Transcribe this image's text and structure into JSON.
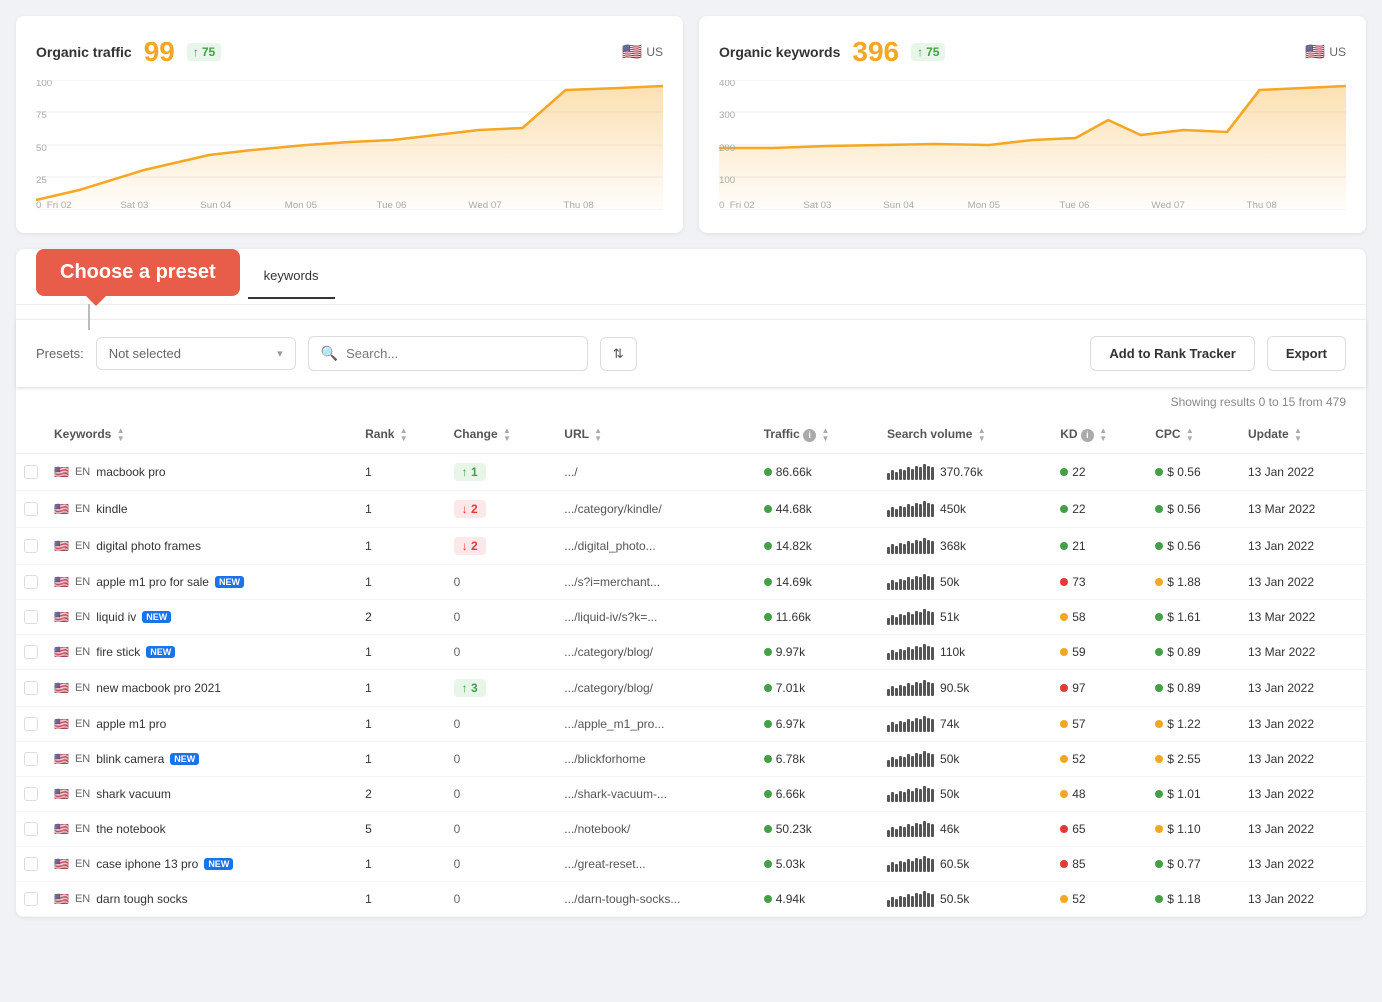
{
  "charts": {
    "organic_traffic": {
      "title": "Organic traffic",
      "value": "99",
      "badge": "75",
      "country": "US",
      "y_labels": [
        "100",
        "75",
        "50",
        "25",
        "0"
      ],
      "x_labels": [
        "Fri 02",
        "Sat 03",
        "Sun 04",
        "Mon 05",
        "Tue 06",
        "Wed 07",
        "Thu 08"
      ]
    },
    "organic_keywords": {
      "title": "Organic keywords",
      "value": "396",
      "badge": "75",
      "country": "US",
      "y_labels": [
        "400",
        "300",
        "200",
        "100",
        "0"
      ],
      "x_labels": [
        "Fri 02",
        "Sat 03",
        "Sun 04",
        "Mon 05",
        "Tue 06",
        "Wed 07",
        "Thu 08"
      ]
    }
  },
  "tabs": [
    {
      "label": "keywords",
      "active": true
    }
  ],
  "tooltip": {
    "text": "Choose a preset"
  },
  "filters": {
    "presets_label": "Presets:",
    "presets_value": "Not selected",
    "search_placeholder": "Search...",
    "add_rank_label": "Add to Rank Tracker",
    "export_label": "Export"
  },
  "table": {
    "results_text": "Showing results 0 to 15 from 479",
    "columns": [
      "Keywords",
      "Rank",
      "Change",
      "URL",
      "Traffic",
      "Search volume",
      "KD",
      "CPC",
      "Update"
    ],
    "rows": [
      {
        "flag": "🇺🇸",
        "lang": "EN",
        "keyword": "macbook pro",
        "new": false,
        "rank": 1,
        "change": "+1",
        "change_type": "up",
        "url": ".../",
        "traffic": "86.66k",
        "traffic_dot": "green",
        "sv": "370.76k",
        "kd": 22,
        "kd_dot": "green",
        "cpc": "$ 0.56",
        "cpc_dot": "green",
        "update": "13 Jan 2022"
      },
      {
        "flag": "🇺🇸",
        "lang": "EN",
        "keyword": "kindle",
        "new": false,
        "rank": 1,
        "change": "-2",
        "change_type": "down",
        "url": ".../category/kindle/",
        "traffic": "44.68k",
        "traffic_dot": "green",
        "sv": "450k",
        "kd": 22,
        "kd_dot": "green",
        "cpc": "$ 0.56",
        "cpc_dot": "green",
        "update": "13 Mar 2022"
      },
      {
        "flag": "🇺🇸",
        "lang": "EN",
        "keyword": "digital photo frames",
        "new": false,
        "rank": 1,
        "change": "-2",
        "change_type": "down",
        "url": ".../digital_photo...",
        "traffic": "14.82k",
        "traffic_dot": "green",
        "sv": "368k",
        "kd": 21,
        "kd_dot": "green",
        "cpc": "$ 0.56",
        "cpc_dot": "green",
        "update": "13 Jan 2022"
      },
      {
        "flag": "🇺🇸",
        "lang": "EN",
        "keyword": "apple m1 pro for sale",
        "new": true,
        "rank": 1,
        "change": "0",
        "change_type": "zero",
        "url": ".../s?i=merchant...",
        "traffic": "14.69k",
        "traffic_dot": "green",
        "sv": "50k",
        "kd": 73,
        "kd_dot": "red",
        "cpc": "$ 1.88",
        "cpc_dot": "yellow",
        "update": "13 Jan 2022"
      },
      {
        "flag": "🇺🇸",
        "lang": "EN",
        "keyword": "liquid iv",
        "new": true,
        "rank": 2,
        "change": "0",
        "change_type": "zero",
        "url": ".../liquid-iv/s?k=...",
        "traffic": "11.66k",
        "traffic_dot": "green",
        "sv": "51k",
        "kd": 58,
        "kd_dot": "yellow",
        "cpc": "$ 1.61",
        "cpc_dot": "green",
        "update": "13 Mar 2022"
      },
      {
        "flag": "🇺🇸",
        "lang": "EN",
        "keyword": "fire stick",
        "new": true,
        "rank": 1,
        "change": "0",
        "change_type": "zero",
        "url": ".../category/blog/",
        "traffic": "9.97k",
        "traffic_dot": "green",
        "sv": "110k",
        "kd": 59,
        "kd_dot": "yellow",
        "cpc": "$ 0.89",
        "cpc_dot": "green",
        "update": "13 Mar 2022"
      },
      {
        "flag": "🇺🇸",
        "lang": "EN",
        "keyword": "new macbook pro 2021",
        "new": false,
        "rank": 1,
        "change": "+3",
        "change_type": "up",
        "url": ".../category/blog/",
        "traffic": "7.01k",
        "traffic_dot": "green",
        "sv": "90.5k",
        "kd": 97,
        "kd_dot": "red",
        "cpc": "$ 0.89",
        "cpc_dot": "green",
        "update": "13 Jan 2022"
      },
      {
        "flag": "🇺🇸",
        "lang": "EN",
        "keyword": "apple m1 pro",
        "new": false,
        "rank": 1,
        "change": "0",
        "change_type": "zero",
        "url": ".../apple_m1_pro...",
        "traffic": "6.97k",
        "traffic_dot": "green",
        "sv": "74k",
        "kd": 57,
        "kd_dot": "yellow",
        "cpc": "$ 1.22",
        "cpc_dot": "yellow",
        "update": "13 Jan 2022"
      },
      {
        "flag": "🇺🇸",
        "lang": "EN",
        "keyword": "blink camera",
        "new": true,
        "rank": 1,
        "change": "0",
        "change_type": "zero",
        "url": ".../blickforhome",
        "traffic": "6.78k",
        "traffic_dot": "green",
        "sv": "50k",
        "kd": 52,
        "kd_dot": "yellow",
        "cpc": "$ 2.55",
        "cpc_dot": "yellow",
        "update": "13 Jan 2022"
      },
      {
        "flag": "🇺🇸",
        "lang": "EN",
        "keyword": "shark vacuum",
        "new": false,
        "rank": 2,
        "change": "0",
        "change_type": "zero",
        "url": ".../shark-vacuum-...",
        "traffic": "6.66k",
        "traffic_dot": "green",
        "sv": "50k",
        "kd": 48,
        "kd_dot": "yellow",
        "cpc": "$ 1.01",
        "cpc_dot": "green",
        "update": "13 Jan 2022"
      },
      {
        "flag": "🇺🇸",
        "lang": "EN",
        "keyword": "the notebook",
        "new": false,
        "rank": 5,
        "change": "0",
        "change_type": "zero",
        "url": ".../notebook/",
        "traffic": "50.23k",
        "traffic_dot": "green",
        "sv": "46k",
        "kd": 65,
        "kd_dot": "red",
        "cpc": "$ 1.10",
        "cpc_dot": "yellow",
        "update": "13 Jan 2022"
      },
      {
        "flag": "🇺🇸",
        "lang": "EN",
        "keyword": "case iphone 13 pro",
        "new": true,
        "rank": 1,
        "change": "0",
        "change_type": "zero",
        "url": ".../great-reset...",
        "traffic": "5.03k",
        "traffic_dot": "green",
        "sv": "60.5k",
        "kd": 85,
        "kd_dot": "red",
        "cpc": "$ 0.77",
        "cpc_dot": "green",
        "update": "13 Jan 2022"
      },
      {
        "flag": "🇺🇸",
        "lang": "EN",
        "keyword": "darn tough socks",
        "new": false,
        "rank": 1,
        "change": "0",
        "change_type": "zero",
        "url": ".../darn-tough-socks...",
        "traffic": "4.94k",
        "traffic_dot": "green",
        "sv": "50.5k",
        "kd": 52,
        "kd_dot": "yellow",
        "cpc": "$ 1.18",
        "cpc_dot": "green",
        "update": "13 Jan 2022"
      }
    ]
  }
}
